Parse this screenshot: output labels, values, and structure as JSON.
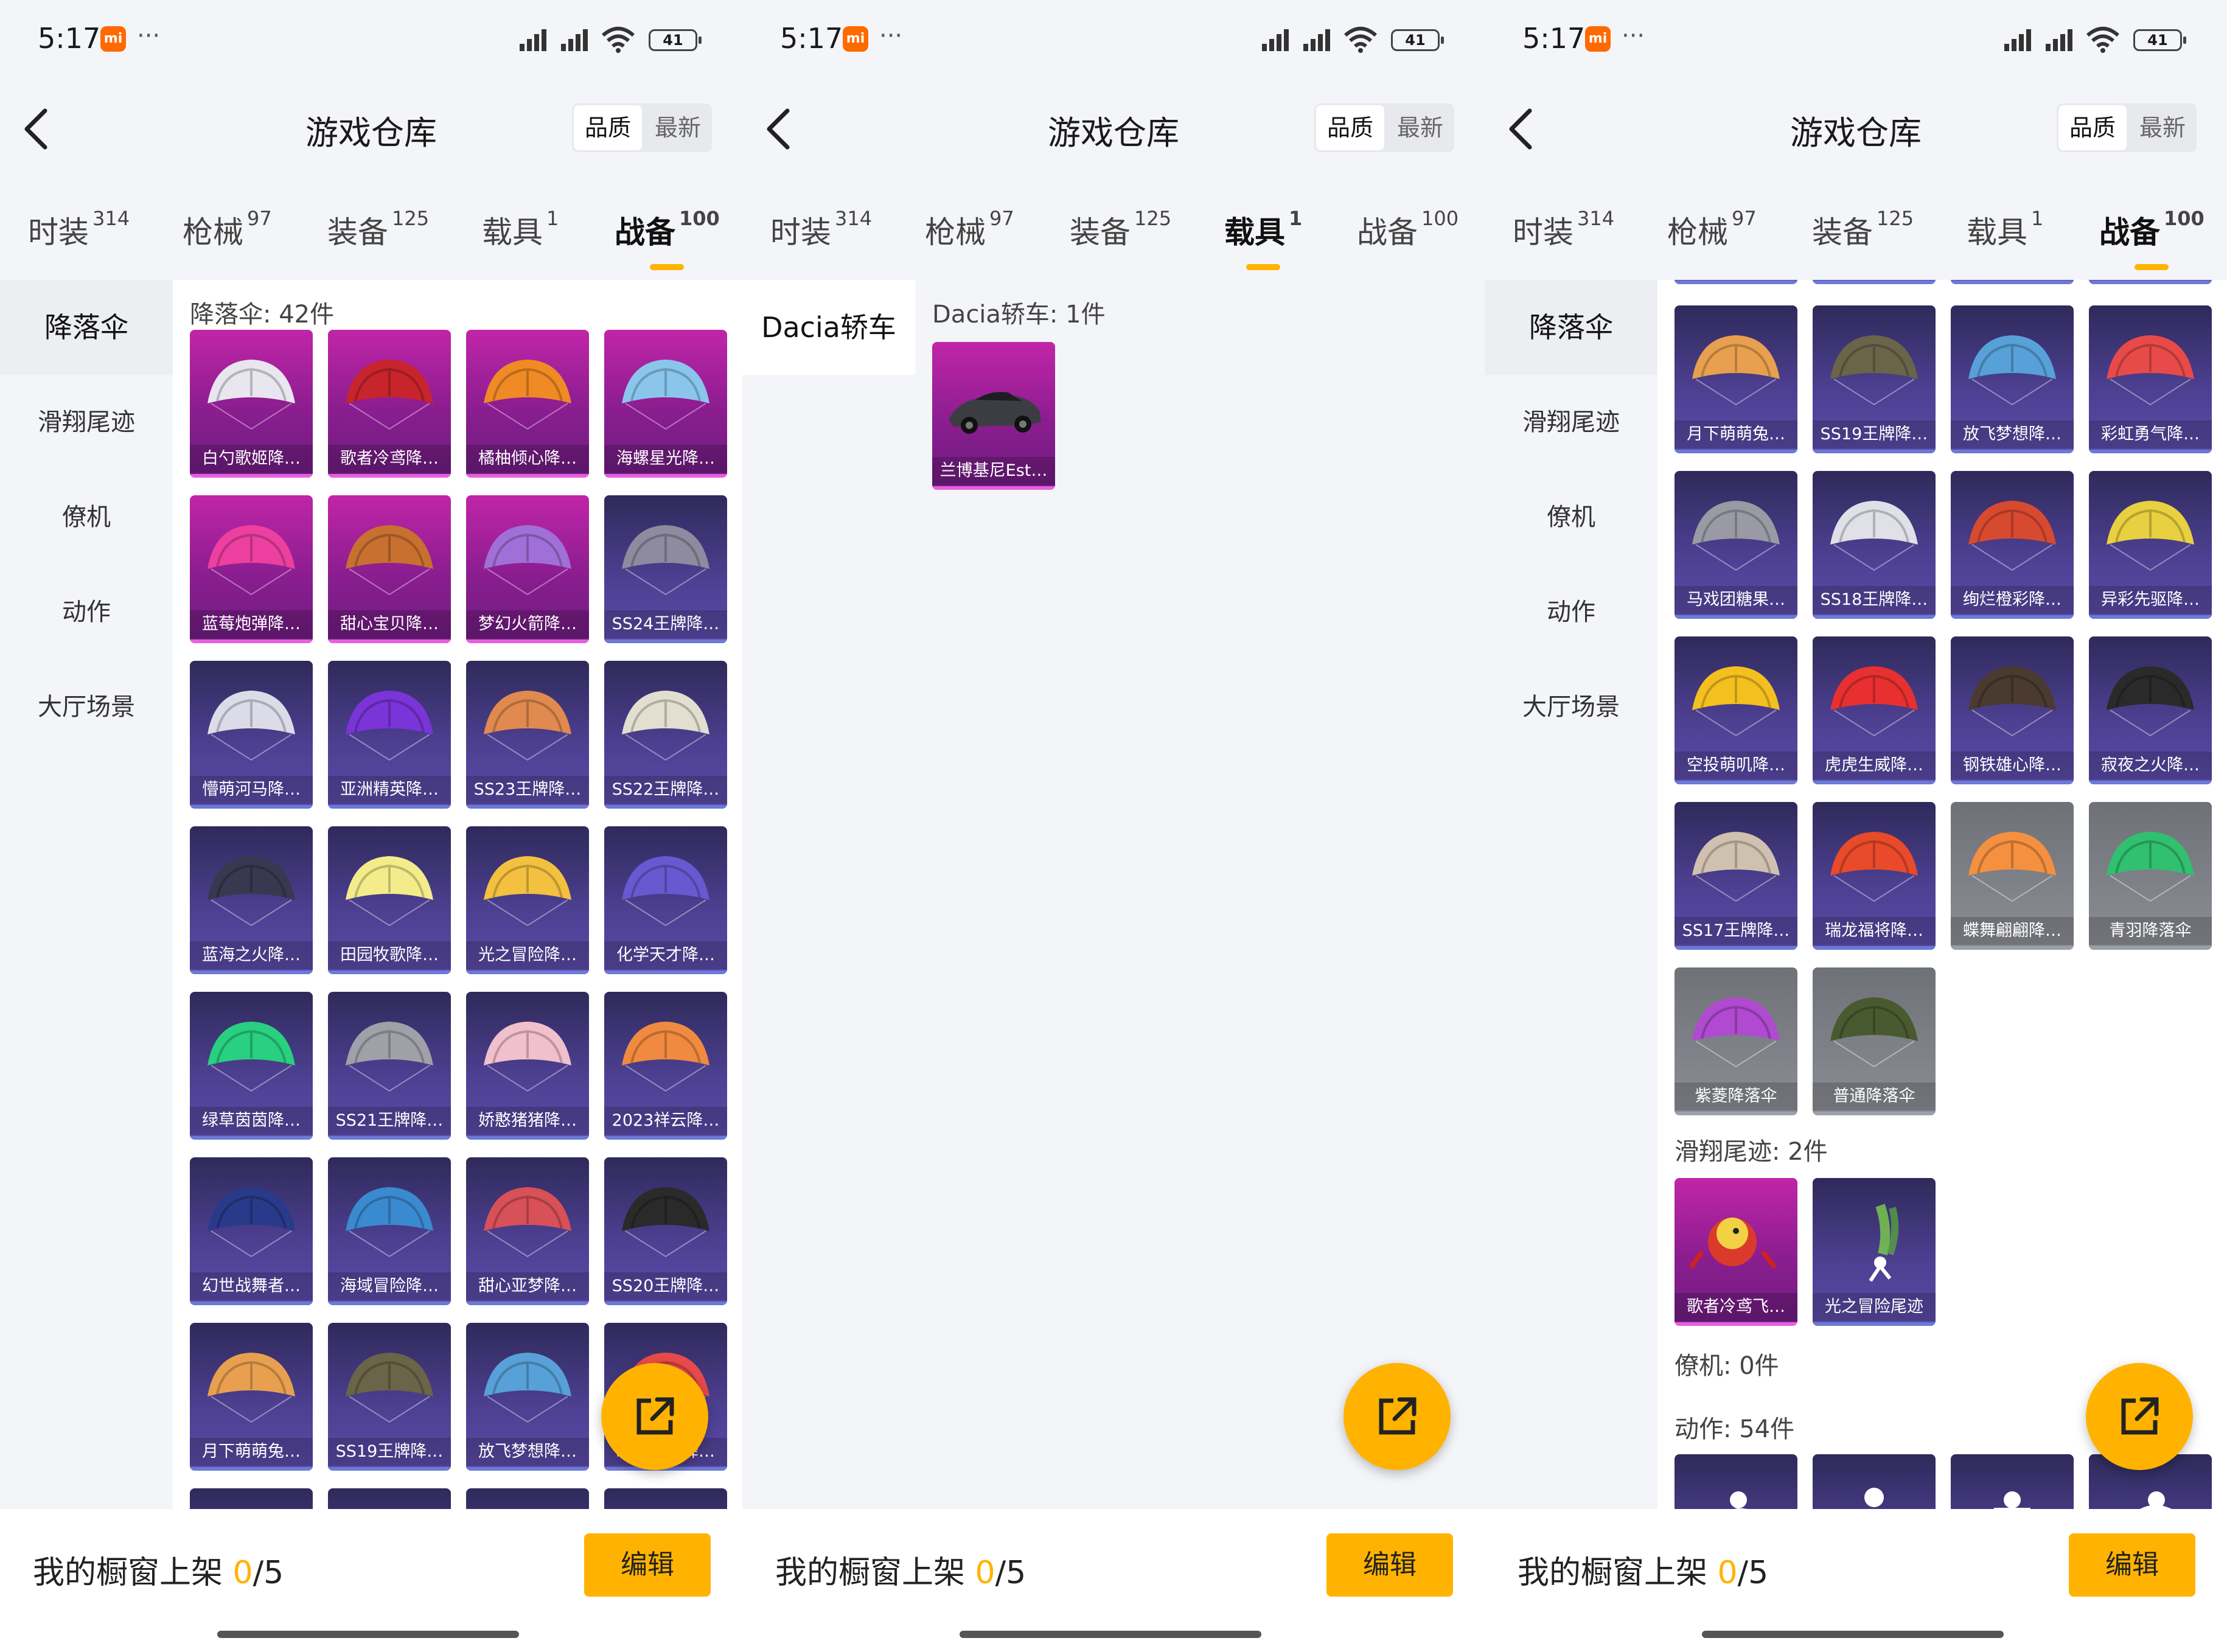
{
  "status_bar": {
    "time": "5:17",
    "battery": "41"
  },
  "header": {
    "title": "游戏仓库",
    "sort_quality": "品质",
    "sort_latest": "最新"
  },
  "tabs": [
    {
      "label": "时装",
      "count": "314"
    },
    {
      "label": "枪械",
      "count": "97"
    },
    {
      "label": "装备",
      "count": "125"
    },
    {
      "label": "载具",
      "count": "1"
    },
    {
      "label": "战备",
      "count": "100"
    }
  ],
  "sidebar_zhanbei": [
    "降落伞",
    "滑翔尾迹",
    "僚机",
    "动作",
    "大厅场景"
  ],
  "sidebar_zaiju": [
    "Dacia轿车"
  ],
  "panel1": {
    "section_title": "降落伞: 42件",
    "items": [
      "白勺歌姬降…",
      "歌者冷鸢降…",
      "橘柚倾心降…",
      "海螺星光降…",
      "蓝莓炮弹降…",
      "甜心宝贝降…",
      "梦幻火箭降…",
      "SS24王牌降…",
      "懵萌河马降…",
      "亚洲精英降…",
      "SS23王牌降…",
      "SS22王牌降…",
      "蓝海之火降…",
      "田园牧歌降…",
      "光之冒险降…",
      "化学天才降…",
      "绿草茵茵降…",
      "SS21王牌降…",
      "娇憨猪猪降…",
      "2023祥云降…",
      "幻世战舞者…",
      "海域冒险降…",
      "甜心亚梦降…",
      "SS20王牌降…",
      "月下萌萌兔…",
      "SS19王牌降…",
      "放飞梦想降…",
      "彩虹勇气降…"
    ]
  },
  "panel2": {
    "section_title": "Dacia轿车: 1件",
    "items": [
      "兰博基尼Est…"
    ]
  },
  "panel3": {
    "items": [
      "月下萌萌兔…",
      "SS19王牌降…",
      "放飞梦想降…",
      "彩虹勇气降…",
      "马戏团糖果…",
      "SS18王牌降…",
      "绚烂橙彩降…",
      "异彩先驱降…",
      "空投萌叽降…",
      "虎虎生威降…",
      "钢铁雄心降…",
      "寂夜之火降…",
      "SS17王牌降…",
      "瑞龙福将降…",
      "蝶舞翩翩降…",
      "青羽降落伞",
      "紫菱降落伞",
      "普通降落伞"
    ],
    "trail_title": "滑翔尾迹: 2件",
    "trail_items": [
      "歌者冷鸢飞…",
      "光之冒险尾迹"
    ],
    "wingman_title": "僚机: 0件",
    "emote_title": "动作: 54件"
  },
  "footer": {
    "label": "我的橱窗上架",
    "current": "0",
    "total": "/5",
    "edit_label": "编辑"
  },
  "colors": {
    "accent": "#ffb300",
    "epic": "#4c3f90",
    "legend": "#b0259e",
    "common": "#8c8e95"
  },
  "icons": [
    "back-arrow-icon",
    "share-icon",
    "xiaomi-icon",
    "signal-icon",
    "wifi-icon",
    "battery-icon"
  ]
}
